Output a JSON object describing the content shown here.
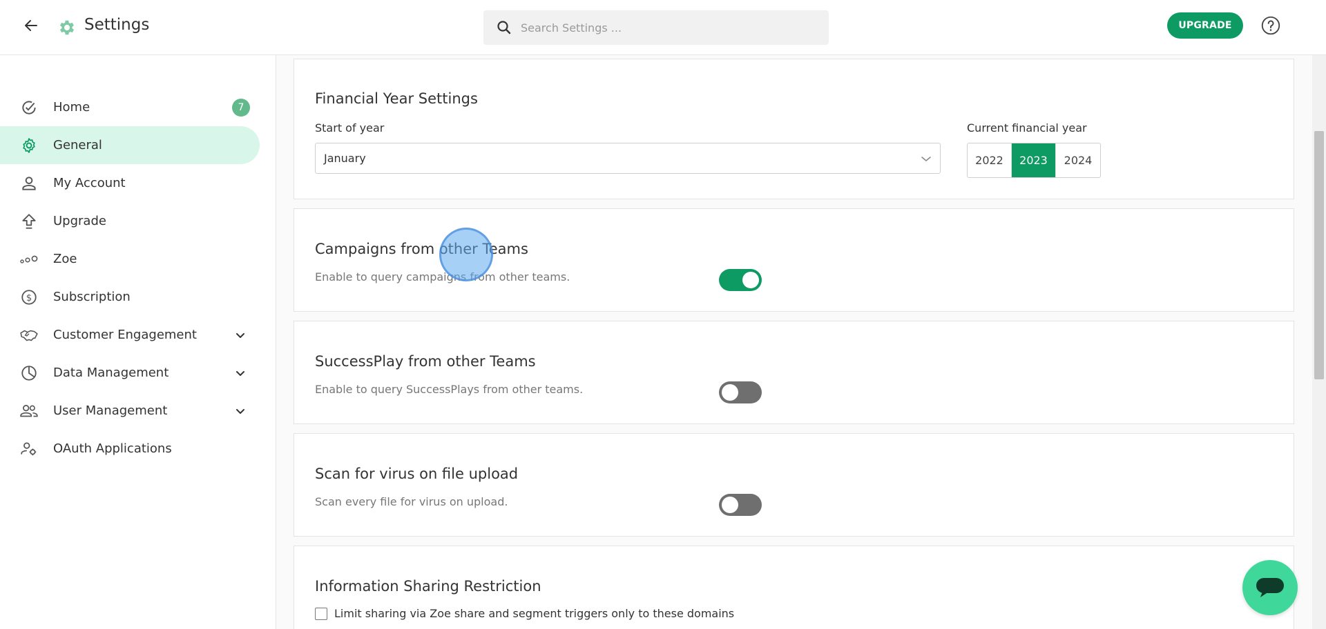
{
  "header": {
    "title": "Settings",
    "search_placeholder": "Search Settings ...",
    "upgrade_label": "UPGRADE"
  },
  "sidebar": {
    "items": [
      {
        "label": "Home",
        "icon": "check-circle-icon",
        "badge": "7"
      },
      {
        "label": "General",
        "icon": "gear-icon",
        "active": true
      },
      {
        "label": "My Account",
        "icon": "person-icon"
      },
      {
        "label": "Upgrade",
        "icon": "upgrade-arrow-icon"
      },
      {
        "label": "Zoe",
        "icon": "zoe-dots-icon"
      },
      {
        "label": "Subscription",
        "icon": "dollar-circle-icon"
      },
      {
        "label": "Customer Engagement",
        "icon": "handshake-icon",
        "expandable": true
      },
      {
        "label": "Data Management",
        "icon": "pie-chart-icon",
        "expandable": true
      },
      {
        "label": "User Management",
        "icon": "users-icon",
        "expandable": true
      },
      {
        "label": "OAuth Applications",
        "icon": "user-gear-icon"
      }
    ]
  },
  "financial_year": {
    "title": "Financial Year Settings",
    "start_label": "Start of year",
    "start_value": "January",
    "current_label": "Current financial year",
    "years": [
      "2022",
      "2023",
      "2024"
    ],
    "selected_year": "2023"
  },
  "campaigns": {
    "title": "Campaigns from other Teams",
    "description": "Enable to query campaigns from other teams.",
    "enabled": true
  },
  "successplay": {
    "title": "SuccessPlay from other Teams",
    "description": "Enable to query SuccessPlays from other teams.",
    "enabled": false
  },
  "virus_scan": {
    "title": "Scan for virus on file upload",
    "description": "Scan every file for virus on upload.",
    "enabled": false
  },
  "info_sharing": {
    "title": "Information Sharing Restriction",
    "checkbox_label": "Limit sharing via Zoe share and segment triggers only to these domains",
    "checked": false
  },
  "colors": {
    "accent": "#0e9b63",
    "active_nav_bg": "#d8f7ea",
    "chat_button": "#3fd89a"
  }
}
